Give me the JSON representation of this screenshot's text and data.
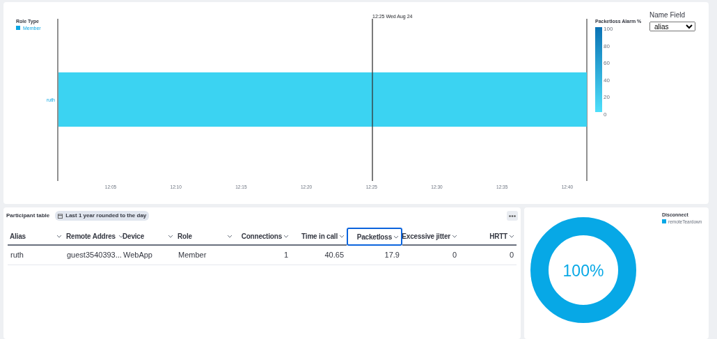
{
  "timeline": {
    "legend_title": "Role Type",
    "legend_items": [
      {
        "label": "Member",
        "color": "#09a6e4"
      }
    ],
    "lanes": [
      {
        "label": "ruth",
        "color": "#3bd3f2"
      }
    ],
    "marker_label": "12:25 Wed Aug 24",
    "x_ticks": [
      "12:05",
      "12:10",
      "12:15",
      "12:20",
      "12:25",
      "12:30",
      "12:35",
      "12:40"
    ],
    "colorbar": {
      "title": "Packetloss Alarm %",
      "ticks": [
        "100",
        "80",
        "60",
        "40",
        "20",
        "0"
      ]
    },
    "name_field": {
      "label": "Name Field",
      "value": "alias"
    }
  },
  "table_panel": {
    "title": "Participant table",
    "time_badge": "Last 1 year rounded to the day",
    "columns": [
      {
        "label": "Alias",
        "kind": "text",
        "focused": false
      },
      {
        "label": "Remote Addres",
        "kind": "text",
        "focused": false
      },
      {
        "label": "Device",
        "kind": "text",
        "focused": false
      },
      {
        "label": "Role",
        "kind": "text",
        "focused": false
      },
      {
        "label": "Connections",
        "kind": "number",
        "focused": false
      },
      {
        "label": "Time in call",
        "kind": "number",
        "focused": false
      },
      {
        "label": "Packetloss",
        "kind": "number",
        "focused": true
      },
      {
        "label": "Excessive jitter",
        "kind": "number",
        "focused": false
      },
      {
        "label": "HRTT",
        "kind": "number",
        "focused": false
      }
    ],
    "rows": [
      [
        "ruth",
        "guest3540393...",
        "WebApp",
        "Member",
        "1",
        "40.65",
        "17.9",
        "0",
        "0"
      ]
    ]
  },
  "donut_panel": {
    "center_label": "100%",
    "legend_title": "Disconnect",
    "legend_items": [
      {
        "label": "remoteTeardown",
        "color": "#07a8e6"
      }
    ]
  }
}
